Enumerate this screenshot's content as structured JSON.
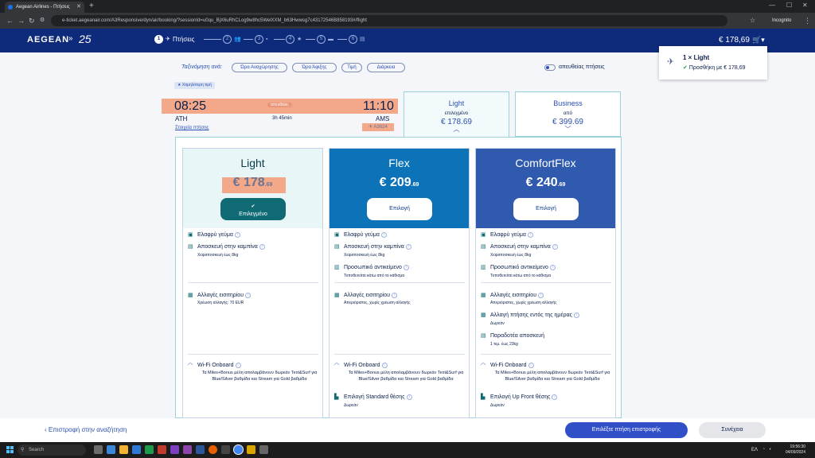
{
  "browser": {
    "tab_title": "Aegean Airlines - Πτήσεις",
    "url": "e-ticket.aegeanair.com/A3Responsive/dyn/air/booking/?sessionId=u0qu_BjX6uRhCLog9w8hc5WelXXM_b63Hwwsg7c43172546B858193#/flight",
    "profile": "Incognito"
  },
  "header": {
    "logo": "AEGEAN",
    "logo_badge": "25",
    "step1_number": "1",
    "step1_label": "Πτήσεις",
    "steps": [
      "2",
      "3",
      "4",
      "5",
      "6"
    ],
    "total_price": "€ 178,69",
    "cart_icon": "cart-icon"
  },
  "cart_popup": {
    "item": "1 × Light",
    "added": "Προσθήκη με € 178,69"
  },
  "sort": {
    "label": "Ταξινόμηση ανά:",
    "options": [
      "Ώρα Αναχώρησης",
      "Ώρα Άφιξης",
      "Τιμή",
      "Διάρκεια"
    ],
    "direct_label": "απευθείας πτήσεις"
  },
  "flight": {
    "lowest_badge": "Χαμηλότερη τιμή",
    "departure_time": "08:25",
    "arrival_time": "11:10",
    "direct_badge": "απευθείας",
    "origin": "ATH",
    "destination": "AMS",
    "duration": "3h 45min",
    "details_link": "Στοιχεία πτήσης",
    "flight_number": "A3624"
  },
  "cabins": {
    "light": {
      "name": "Light",
      "status": "επιλεγμένο",
      "price": "€ 178.69"
    },
    "business": {
      "name": "Business",
      "status": "από",
      "price": "€ 399.69"
    }
  },
  "fares": {
    "light": {
      "title": "Light",
      "price_main": "€ 178",
      "price_dec": ".69",
      "button": "Επιλεγμένο",
      "meal": "Ελαφρύ γεύμα",
      "cabin_bag": "Αποσκευή στην καμπίνα",
      "cabin_bag_sub": "Χειραποσκευή έως 8kg",
      "changes": "Αλλαγές εισιτηρίου",
      "changes_sub": "Χρέωση αλλαγής: 70 EUR",
      "wifi": "Wi-Fi Onboard",
      "wifi_sub": "Τα Miles+Bonus μέλη απολαμβάνουν δωρεάν Text&Surf για Blue/Silver βαθμίδα και Stream για Gold βαθμίδα"
    },
    "flex": {
      "title": "Flex",
      "price_main": "€ 209",
      "price_dec": ".69",
      "button": "Επιλογή",
      "meal": "Ελαφρύ γεύμα",
      "cabin_bag": "Αποσκευή στην καμπίνα",
      "cabin_bag_sub": "Χειραποσκευή έως 8kg",
      "personal": "Προσωπικό αντικείμενο",
      "personal_sub": "Τοποθετείται κάτω από το κάθισμα",
      "changes": "Αλλαγές εισιτηρίου",
      "changes_sub": "Απεριόριστες, χωρίς χρέωση αλλαγής",
      "wifi": "Wi-Fi Onboard",
      "wifi_sub": "Τα Miles+Bonus μέλη απολαμβάνουν δωρεάν Text&Surf για Blue/Silver βαθμίδα και Stream για Gold βαθμίδα",
      "seat": "Επιλογή Standard θέσης",
      "seat_sub": "Δωρεάν"
    },
    "comfort": {
      "title": "ComfortFlex",
      "price_main": "€ 240",
      "price_dec": ".69",
      "button": "Επιλογή",
      "meal": "Ελαφρύ γεύμα",
      "cabin_bag": "Αποσκευή στην καμπίνα",
      "cabin_bag_sub": "Χειραποσκευή έως 8kg",
      "personal": "Προσωπικό αντικείμενο",
      "personal_sub": "Τοποθετείται κάτω από το κάθισμα",
      "changes": "Αλλαγές εισιτηρίου",
      "changes_sub": "Απεριόριστες, χωρίς χρέωση αλλαγής",
      "sameday": "Αλλαγή πτήσης εντός της ημέρας",
      "sameday_sub": "Δωρεάν",
      "checked": "Παραδοτέα αποσκευή",
      "checked_sub": "1 τεμ. έως 23kg",
      "wifi": "Wi-Fi Onboard",
      "wifi_sub": "Τα Miles+Bonus μέλη απολαμβάνουν δωρεάν Text&Surf για Blue/Silver βαθμίδα και Stream για Gold βαθμίδα",
      "seat": "Επιλογή Up Front θέσης",
      "seat_sub": "Δωρεάν"
    }
  },
  "footer": {
    "back": "Επιστροφή στην αναζήτηση",
    "return_flight": "Επιλέξτε πτήση επιστροφής",
    "continue": "Συνέχεια"
  },
  "taskbar": {
    "search": "Search",
    "lang": "ΕΛ",
    "time": "19:56:30",
    "date": "04/09/2024"
  }
}
